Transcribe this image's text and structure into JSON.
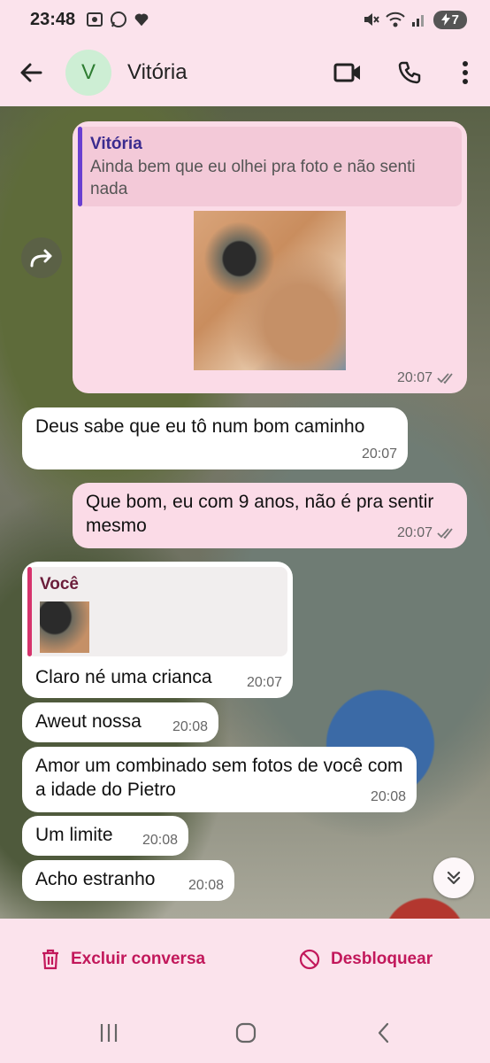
{
  "status_bar": {
    "time": "23:48",
    "battery": "7"
  },
  "header": {
    "avatar_initial": "V",
    "contact_name": "Vitória"
  },
  "messages": {
    "m1": {
      "quote_author": "Vitória",
      "quote_text": "Ainda bem que eu olhei pra foto e não senti nada",
      "time": "20:07"
    },
    "m2": {
      "text": "Deus sabe que eu tô num bom caminho",
      "time": "20:07"
    },
    "m3": {
      "text": "Que bom, eu com 9 anos, não é pra sentir mesmo",
      "time": "20:07"
    },
    "m4": {
      "quote_author": "Você",
      "text": "Claro né uma crianca",
      "time": "20:07"
    },
    "m5": {
      "text": "Aweut nossa",
      "time": "20:08"
    },
    "m6": {
      "text": "Amor um combinado sem fotos de você com a idade do Pietro",
      "time": "20:08"
    },
    "m7": {
      "text": "Um limite",
      "time": "20:08"
    },
    "m8": {
      "text": "Acho estranho",
      "time": "20:08"
    }
  },
  "actions": {
    "delete_label": "Excluir conversa",
    "unblock_label": "Desbloquear"
  },
  "colors": {
    "accent": "#c2185b",
    "outgoing_bubble": "#fbdbe7",
    "incoming_bubble": "#ffffff",
    "background": "#fbe3ec"
  }
}
